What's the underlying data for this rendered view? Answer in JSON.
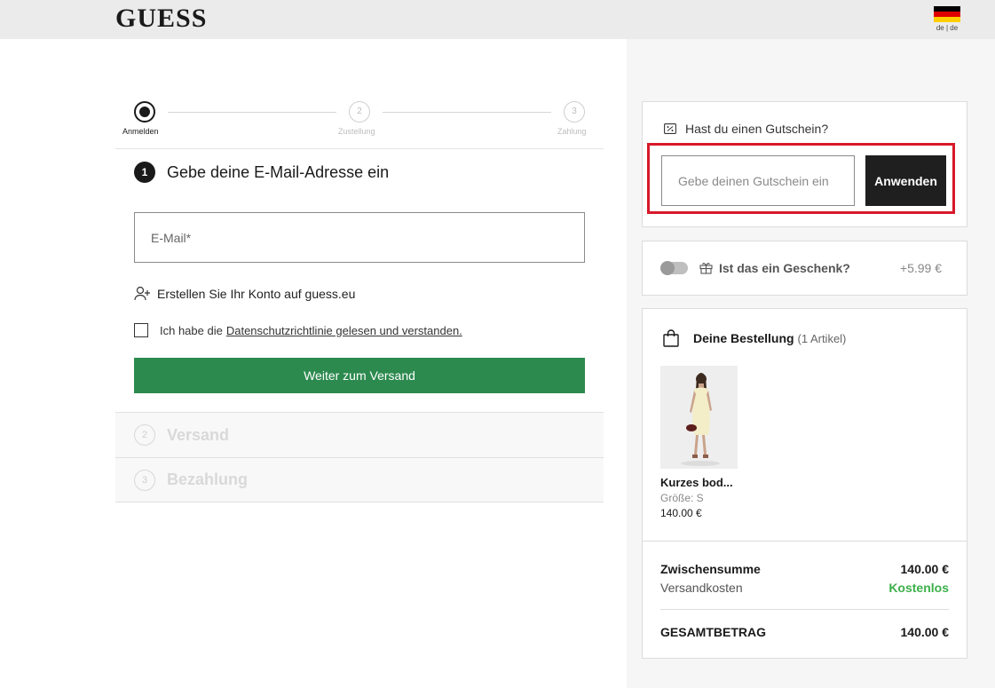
{
  "header": {
    "logo": "GUESS",
    "lang": "de | de",
    "flag_colors": [
      "#000000",
      "#dd0000",
      "#ffce00"
    ]
  },
  "stepper": {
    "steps": [
      {
        "num": "1",
        "label": "Anmelden"
      },
      {
        "num": "2",
        "label": "Zustellung"
      },
      {
        "num": "3",
        "label": "Zahlung"
      }
    ]
  },
  "login": {
    "section_num": "1",
    "title": "Gebe deine E-Mail-Adresse ein",
    "email_placeholder": "E-Mail*",
    "create_account": "Erstellen Sie Ihr Konto auf guess.eu",
    "privacy_prefix": "Ich habe die",
    "privacy_link": "Datenschutzrichtlinie gelesen und verstanden.",
    "continue_button": "Weiter zum Versand"
  },
  "sections": [
    {
      "num": "2",
      "title": "Versand"
    },
    {
      "num": "3",
      "title": "Bezahlung"
    }
  ],
  "coupon": {
    "heading": "Hast du einen Gutschein?",
    "placeholder": "Gebe deinen Gutschein ein",
    "apply_button": "Anwenden"
  },
  "gift": {
    "label": "Ist das ein Geschenk?",
    "price": "+5.99 €"
  },
  "order": {
    "title": "Deine Bestellung",
    "count": "(1 Artikel)",
    "product": {
      "name": "Kurzes bod...",
      "size": "Größe: S",
      "price": "140.00 €"
    },
    "subtotal_label": "Zwischensumme",
    "subtotal_value": "140.00 €",
    "shipping_label": "Versandkosten",
    "shipping_value": "Kostenlos",
    "total_label": "GESAMTBETRAG",
    "total_value": "140.00 €"
  },
  "colors": {
    "accent_green": "#2c8a4e",
    "free_green": "#3cb04a",
    "highlight_red": "#d7192a"
  }
}
